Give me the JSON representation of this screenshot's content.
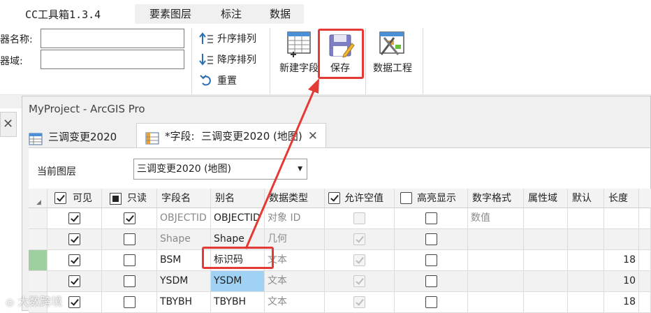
{
  "app": {
    "title": "CC工具箱1.3.4"
  },
  "ribbon": {
    "tabs": [
      "要素图层",
      "标注",
      "数据"
    ],
    "fields": {
      "name_label": "器名称:",
      "domain_label": "器域:",
      "name_value": "",
      "domain_value": ""
    },
    "sort": {
      "asc": "升序排列",
      "desc": "降序排列",
      "reset": "重置"
    },
    "buttons": {
      "new_field": "新建字段",
      "save": "保存",
      "data_engineering": "数据工程"
    }
  },
  "window": {
    "title": "MyProject - ArcGIS Pro",
    "tabs": [
      {
        "label": "三调变更2020"
      },
      {
        "label": "*字段:  三调变更2020 (地图)"
      }
    ],
    "current_layer_label": "当前图层",
    "current_layer_value": "三调变更2020 (地图)"
  },
  "grid": {
    "headers": {
      "visible": "可见",
      "readonly": "只读",
      "field_name": "字段名",
      "alias": "别名",
      "data_type": "数据类型",
      "allow_null": "允许空值",
      "highlight": "高亮显示",
      "number_format": "数字格式",
      "domain": "属性域",
      "default": "默认",
      "length": "长度"
    },
    "rows": [
      {
        "visible": true,
        "readonly": true,
        "field_name": "OBJECTID",
        "alias": "OBJECTID",
        "data_type": "对象 ID",
        "allow_null": false,
        "highlight": false,
        "number_format": "数值",
        "length": "",
        "selected": false,
        "marker": false
      },
      {
        "visible": true,
        "readonly": false,
        "field_name": "Shape",
        "alias": "Shape",
        "data_type": "几何",
        "allow_null": true,
        "highlight": false,
        "number_format": "",
        "length": "",
        "selected": false,
        "marker": false
      },
      {
        "visible": true,
        "readonly": false,
        "field_name": "BSM",
        "alias": "标识码",
        "data_type": "文本",
        "allow_null": true,
        "highlight": false,
        "number_format": "",
        "length": "18",
        "selected": false,
        "marker": true
      },
      {
        "visible": true,
        "readonly": false,
        "field_name": "YSDM",
        "alias": "YSDM",
        "data_type": "文本",
        "allow_null": true,
        "highlight": false,
        "number_format": "",
        "length": "10",
        "selected": true,
        "marker": false
      },
      {
        "visible": true,
        "readonly": false,
        "field_name": "TBYBH",
        "alias": "TBYBH",
        "data_type": "文本",
        "allow_null": true,
        "highlight": false,
        "number_format": "",
        "length": "18",
        "selected": false,
        "marker": false
      }
    ]
  },
  "watermark": "大数跨境",
  "colors": {
    "accent_red": "#e53935",
    "selection_blue": "#9fd2f5",
    "row_marker_green": "#9fcf9f",
    "header_bg": "#f3f3f3"
  }
}
